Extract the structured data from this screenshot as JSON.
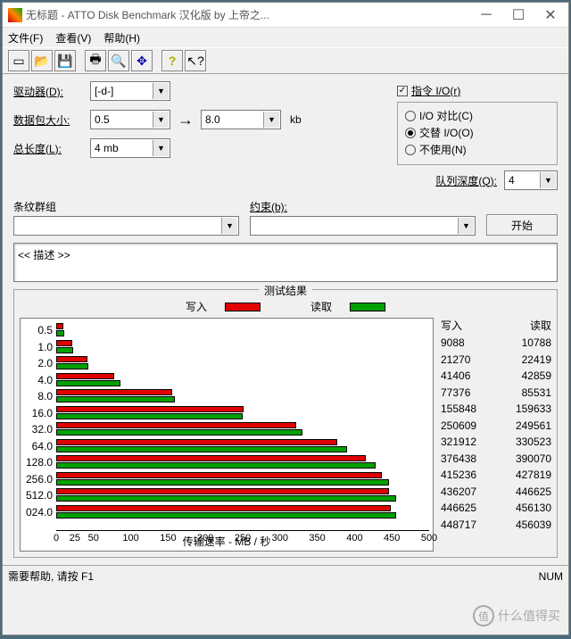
{
  "window": {
    "title": "无标题 - ATTO Disk Benchmark  汉化版 by 上帝之..."
  },
  "menus": {
    "file": "文件(F)",
    "view": "查看(V)",
    "help": "帮助(H)"
  },
  "labels": {
    "drive": "驱动器(D):",
    "packet": "数据包大小:",
    "length": "总长度(L):",
    "queue": "队列深度(Q):",
    "stripe": "条纹群组",
    "constraint": "约束(b):"
  },
  "values": {
    "drive": "[-d-]",
    "packet_from": "0.5",
    "packet_to": "8.0",
    "packet_unit": "kb",
    "length": "4 mb",
    "queue": "4"
  },
  "options": {
    "cmd_io": "指令 I/O(r)",
    "io_compare": "I/O 对比(C)",
    "alt_io": "交替 I/O(O)",
    "no_use": "不使用(N)"
  },
  "buttons": {
    "start": "开始"
  },
  "desc": "<< 描述 >>",
  "results_title": "测试结果",
  "legend": {
    "write": "写入",
    "read": "读取"
  },
  "table_headers": {
    "write": "写入",
    "read": "读取"
  },
  "xlabel": "传输速率 - MB / 秒",
  "xticks": [
    "0",
    "25",
    "50",
    "100",
    "150",
    "200",
    "250",
    "300",
    "350",
    "400",
    "450",
    "500"
  ],
  "statusbar": {
    "text": "需要帮助, 请按 F1",
    "num": "NUM"
  },
  "watermark": {
    "badge": "值",
    "text": "什么值得买"
  },
  "chart_data": {
    "type": "bar",
    "categories": [
      "0.5",
      "1.0",
      "2.0",
      "4.0",
      "8.0",
      "16.0",
      "32.0",
      "64.0",
      "128.0",
      "256.0",
      "512.0",
      "024.0"
    ],
    "xmax": 500000,
    "xlabel": "传输速率 - MB / 秒",
    "series": [
      {
        "name": "写入",
        "color": "#e00000",
        "values": [
          9088,
          21270,
          41406,
          77376,
          155848,
          250609,
          321912,
          376438,
          415236,
          436207,
          446625,
          448717
        ]
      },
      {
        "name": "读取",
        "color": "#00a000",
        "values": [
          10788,
          22419,
          42859,
          85531,
          159633,
          249561,
          330523,
          390070,
          427819,
          446625,
          456130,
          456039
        ]
      }
    ]
  }
}
